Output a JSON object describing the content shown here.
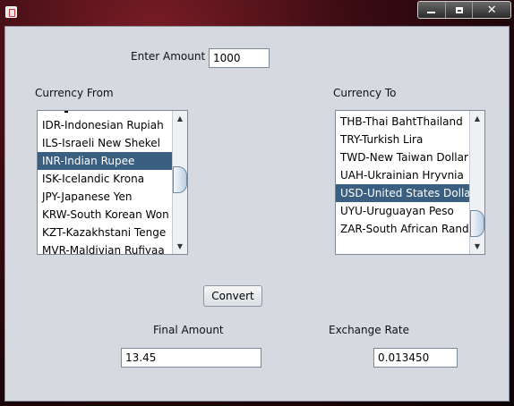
{
  "window": {
    "app_icon": "java-cup-icon",
    "controls": {
      "minimize": "minimize-icon",
      "maximize": "maximize-icon",
      "close": "close-icon",
      "close_glyph": "✕"
    }
  },
  "amount": {
    "label": "Enter Amount",
    "value": "1000"
  },
  "currency_from": {
    "label": "Currency From",
    "items": [
      "IDR-Indonesian Rupiah",
      "ILS-Israeli New Shekel",
      "INR-Indian Rupee",
      "ISK-Icelandic Krona",
      "JPY-Japanese Yen",
      "KRW-South Korean Won",
      "KZT-Kazakhstani Tenge",
      "MVR-Maldivian Rufiyaa"
    ],
    "selected": "INR-Indian Rupee"
  },
  "currency_to": {
    "label": "Currency To",
    "items": [
      "THB-Thai BahtThailand",
      "TRY-Turkish Lira",
      "TWD-New Taiwan Dollar",
      "UAH-Ukrainian Hryvnia",
      "USD-United States Dollar",
      "UYU-Uruguayan Peso",
      "ZAR-South African Rand"
    ],
    "selected": "USD-United States Dollar"
  },
  "convert_button": {
    "label": "Convert"
  },
  "final_amount": {
    "label": "Final Amount",
    "value": "13.45"
  },
  "exchange_rate": {
    "label": "Exchange Rate",
    "value": "0.013450"
  },
  "colors": {
    "selection": "#3a5f80",
    "panel": "#d6d9df"
  }
}
